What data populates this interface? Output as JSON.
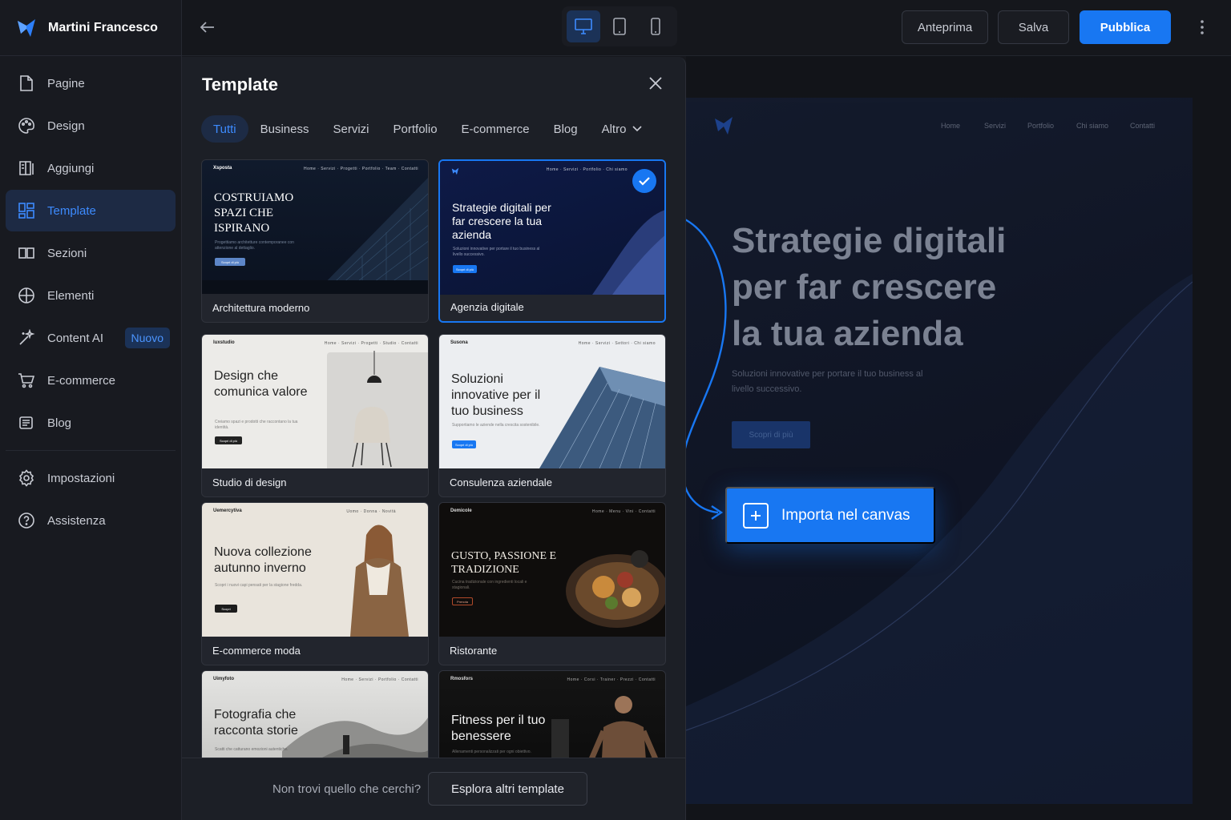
{
  "user": {
    "name": "Martini Francesco",
    "logo_icon": "logo-mark-icon"
  },
  "sidebar": {
    "items": [
      {
        "label": "Pagine",
        "icon": "page-icon"
      },
      {
        "label": "Design",
        "icon": "palette-icon"
      },
      {
        "label": "Aggiungi",
        "icon": "book-add-icon"
      },
      {
        "label": "Template",
        "icon": "template-grid-icon",
        "active": true
      },
      {
        "label": "Sezioni",
        "icon": "sections-icon"
      },
      {
        "label": "Elementi",
        "icon": "elements-icon"
      },
      {
        "label": "Content AI",
        "icon": "sparkle-icon",
        "badge": "Nuovo"
      },
      {
        "label": "E-commerce",
        "icon": "cart-icon"
      },
      {
        "label": "Blog",
        "icon": "blog-icon"
      }
    ],
    "bottom_items": [
      {
        "label": "Impostazioni",
        "icon": "gear-icon"
      },
      {
        "label": "Assistenza",
        "icon": "help-icon"
      }
    ]
  },
  "topbar": {
    "preview_label": "Anteprima",
    "save_label": "Salva",
    "publish_label": "Pubblica",
    "active_device": "desktop"
  },
  "panel": {
    "title": "Template",
    "filters": [
      "Tutti",
      "Business",
      "Servizi",
      "Portfolio",
      "E-commerce",
      "Blog",
      "Altro"
    ],
    "active_filter": "Tutti",
    "templates": [
      {
        "label": "Architettura moderno",
        "headline": "COSTRUIAMO SPAZI CHE ISPIRANO",
        "logo": "Xsposta"
      },
      {
        "label": "Agenzia digitale",
        "headline": "Strategie digitali per far crescere la tua azienda",
        "selected": true
      },
      {
        "label": "Studio di design",
        "headline": "Design che comunica valore",
        "logo": "luxstudio"
      },
      {
        "label": "Consulenza aziendale",
        "headline": "Soluzioni innovative per il tuo business",
        "logo": "Susona"
      },
      {
        "label": "E-commerce moda",
        "headline": "Nuova collezione autunno inverno",
        "logo": "Uemercytiva"
      },
      {
        "label": "Ristorante",
        "headline": "GUSTO, PASSIONE E TRADIZIONE",
        "logo": "Demicole"
      },
      {
        "label": "",
        "headline": "Fotografia che racconta storie",
        "logo": "Uimyfoto"
      },
      {
        "label": "",
        "headline": "Fitness per il tuo benessere",
        "logo": "Rmosfors"
      }
    ],
    "footer_text": "Non trovi quello che cerchi?",
    "footer_button": "Esplora altri template"
  },
  "canvas": {
    "nav": [
      "Home",
      "Servizi",
      "Portfolio",
      "Chi siamo",
      "Contatti"
    ],
    "headline": "Strategie digitali per far crescere la tua azienda",
    "subtext": "Soluzioni innovative per portare il tuo business al livello successivo.",
    "cta": "Scopri di più",
    "import_label": "Importa nel canvas"
  },
  "colors": {
    "accent": "#1877f2",
    "bg": "#16181d",
    "panel": "#1c1f26"
  }
}
